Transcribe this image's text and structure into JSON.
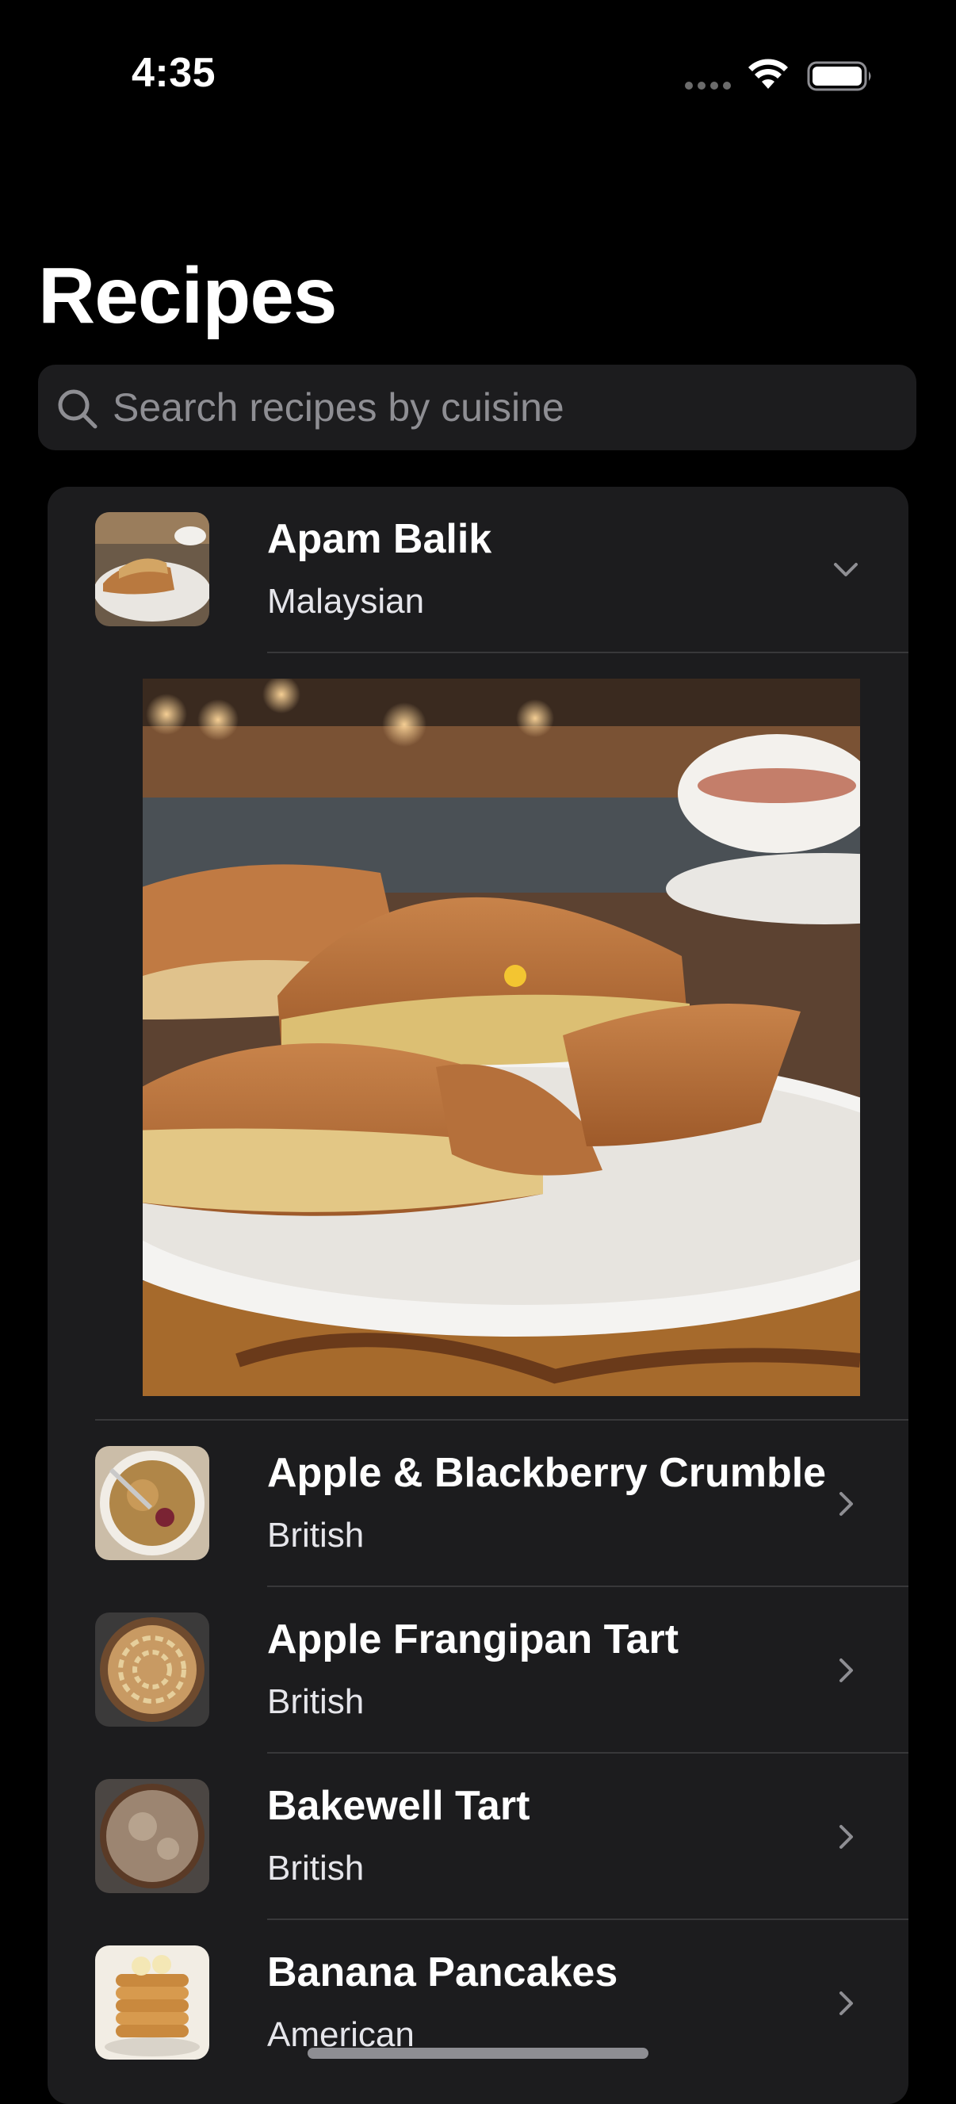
{
  "status_bar": {
    "time": "4:35",
    "icons": [
      "signal-dots-icon",
      "wifi-icon",
      "battery-icon"
    ]
  },
  "header": {
    "title": "Recipes"
  },
  "search": {
    "placeholder": "Search recipes by cuisine",
    "value": "",
    "icon": "search-icon"
  },
  "recipes": [
    {
      "name": "Apam Balik",
      "cuisine": "Malaysian",
      "expanded": true,
      "chevron": "chevron-down-icon"
    },
    {
      "name": "Apple & Blackberry Crumble",
      "cuisine": "British",
      "expanded": false,
      "chevron": "chevron-right-icon"
    },
    {
      "name": "Apple Frangipan Tart",
      "cuisine": "British",
      "expanded": false,
      "chevron": "chevron-right-icon"
    },
    {
      "name": "Bakewell Tart",
      "cuisine": "British",
      "expanded": false,
      "chevron": "chevron-right-icon"
    },
    {
      "name": "Banana Pancakes",
      "cuisine": "American",
      "expanded": false,
      "chevron": "chevron-right-icon"
    }
  ],
  "colors": {
    "background": "#000000",
    "card": "#1c1c1e",
    "separator": "#38383a",
    "secondary_text": "#8e8e93"
  }
}
